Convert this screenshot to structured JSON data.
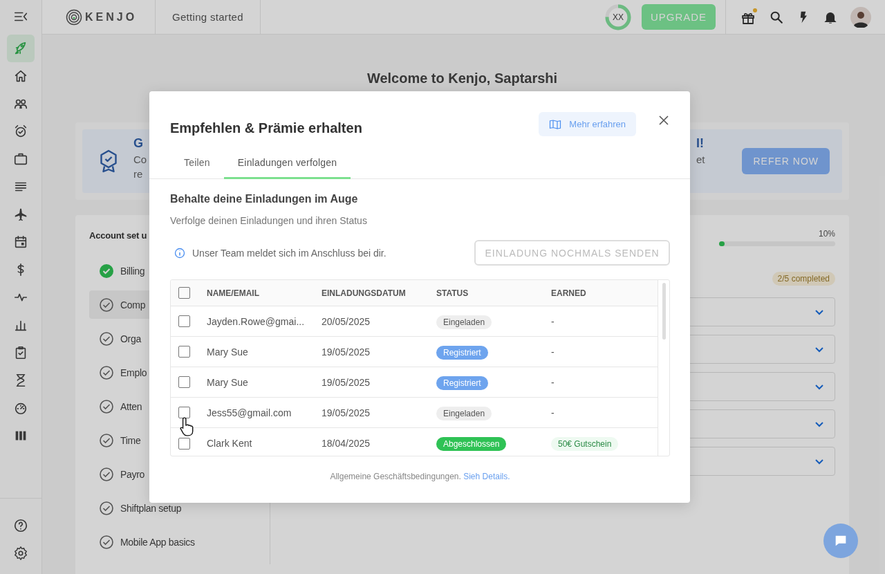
{
  "topbar": {
    "brand": "KENJO",
    "section": "Getting started",
    "trial_ring": {
      "initials": "XX",
      "level": 0.75
    },
    "upgrade_button": "UPGRADE",
    "gift_has_dot": true
  },
  "sidebar": {
    "items": [
      {
        "selected": true
      },
      {
        "selected": false
      },
      {
        "selected": false
      },
      {
        "selected": false
      },
      {
        "selected": false
      },
      {
        "selected": false
      },
      {
        "selected": false
      },
      {
        "selected": false
      },
      {
        "selected": false
      },
      {
        "selected": false
      },
      {
        "selected": false
      },
      {
        "selected": false
      },
      {
        "selected": false
      },
      {
        "selected": false
      },
      {
        "selected": false
      }
    ]
  },
  "page": {
    "title": "Welcome to Kenjo, Saptarshi",
    "banner": {
      "title_left": "G",
      "text_left_1": "Co",
      "text_left_2": "re",
      "title_right": "l!",
      "text_right": "et",
      "button": "REFER NOW"
    },
    "setup": {
      "title": "Account set u",
      "progress": {
        "reading": "10%",
        "level": 0.05
      },
      "completed_badge": "2/5 completed",
      "items": [
        {
          "label": "Billing",
          "done": true,
          "selected": false
        },
        {
          "label": "Comp",
          "done": false,
          "selected": true
        },
        {
          "label": "Orga",
          "done": false,
          "selected": false
        },
        {
          "label": "Emplo",
          "done": false,
          "selected": false
        },
        {
          "label": "Atten",
          "done": false,
          "selected": false
        },
        {
          "label": "Time",
          "done": false,
          "selected": false
        },
        {
          "label": "Payro",
          "done": false,
          "selected": false
        },
        {
          "label": "Shiftplan setup",
          "done": false,
          "selected": false
        },
        {
          "label": "Mobile App basics",
          "done": false,
          "selected": false
        }
      ]
    }
  },
  "modal": {
    "title": "Empfehlen & Prämie erhalten",
    "learn_more_button": "Mehr erfahren",
    "tabs": [
      {
        "label": "Teilen",
        "selected": false
      },
      {
        "label": "Einladungen verfolgen",
        "selected": true
      }
    ],
    "heading": "Behalte deine Einladungen im Auge",
    "subheading": "Verfolge deinen Einladungen und ihren Status",
    "info": "Unser Team meldet sich im Anschluss bei dir.",
    "resend_button": {
      "label": "EINLADUNG NOCHMALS SENDEN",
      "disabled": true
    },
    "table": {
      "header_checked": false,
      "columns": [
        "NAME/EMAIL",
        "EINLADUNGSDATUM",
        "STATUS",
        "EARNED"
      ],
      "rows": [
        {
          "checked": false,
          "name": "Jayden.Rowe@gmai...",
          "date": "20/05/2025",
          "status": {
            "text": "Eingeladen",
            "kind": "invited"
          },
          "earned": {
            "text": "-",
            "kind": "plain"
          }
        },
        {
          "checked": false,
          "name": "Mary Sue",
          "date": "19/05/2025",
          "status": {
            "text": "Registriert",
            "kind": "registered"
          },
          "earned": {
            "text": "-",
            "kind": "plain"
          }
        },
        {
          "checked": false,
          "name": "Mary Sue",
          "date": "19/05/2025",
          "status": {
            "text": "Registriert",
            "kind": "registered"
          },
          "earned": {
            "text": "-",
            "kind": "plain"
          }
        },
        {
          "checked": false,
          "name": "Jess55@gmail.com",
          "date": "19/05/2025",
          "status": {
            "text": "Eingeladen",
            "kind": "invited"
          },
          "earned": {
            "text": "-",
            "kind": "plain"
          }
        },
        {
          "checked": false,
          "name": "Clark Kent",
          "date": "18/04/2025",
          "status": {
            "text": "Abgeschlossen",
            "kind": "completed"
          },
          "earned": {
            "text": "50€ Gutschein",
            "kind": "reward"
          }
        }
      ]
    },
    "footer_text": "Allgemeine Geschäftsbedingungen.",
    "footer_link": "Sieh Details."
  }
}
